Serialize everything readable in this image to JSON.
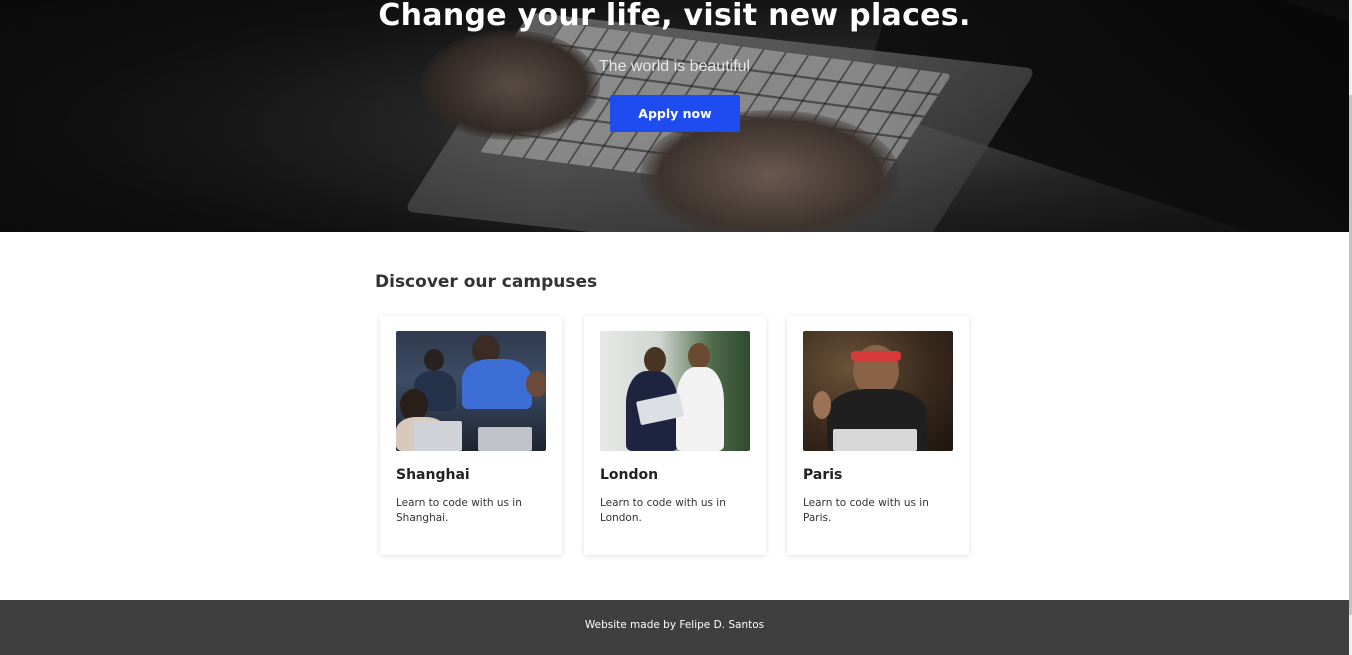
{
  "hero": {
    "title": "Change your life, visit new places.",
    "subtitle": "The world is beautiful",
    "cta_label": "Apply now"
  },
  "campuses": {
    "heading": "Discover our campuses",
    "items": [
      {
        "city": "Shanghai",
        "description": "Learn to code with us in Shanghai."
      },
      {
        "city": "London",
        "description": "Learn to code with us in London."
      },
      {
        "city": "Paris",
        "description": "Learn to code with us in Paris."
      }
    ]
  },
  "footer": {
    "credit": "Website made by Felipe D. Santos"
  },
  "colors": {
    "accent": "#1f4cf0",
    "footer_bg": "#3f3f3f"
  }
}
